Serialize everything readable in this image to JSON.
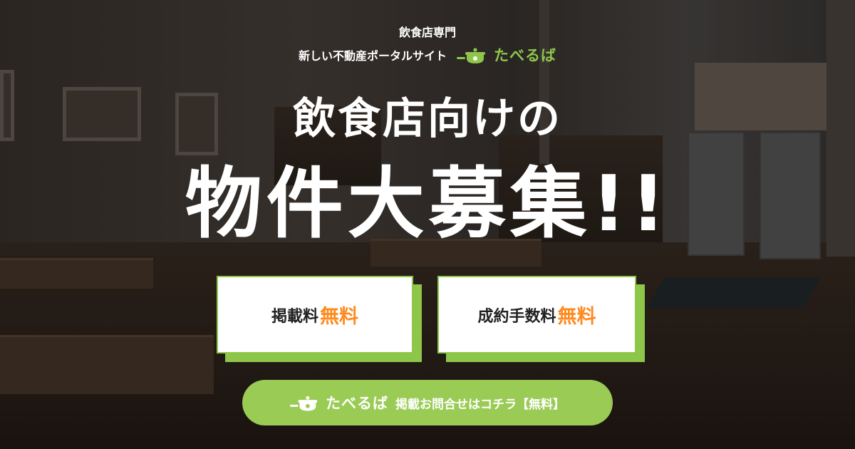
{
  "header": {
    "line1": "飲食店専門",
    "line2": "新しい不動産ポータルサイト",
    "brand_name": "たべるば",
    "brand_icon": "pot-icon"
  },
  "hero": {
    "headline1": "飲食店向けの",
    "headline2": "物件大募集!!"
  },
  "cards": [
    {
      "label": "掲載料",
      "highlight": "無料"
    },
    {
      "label": "成約手数料",
      "highlight": "無料"
    }
  ],
  "cta": {
    "brand_name": "たべるば",
    "label": "掲載お問合せはコチラ【無料】"
  },
  "colors": {
    "accent_green": "#8ec64a",
    "cta_green": "#9acb55",
    "highlight_orange": "#ff8a1e",
    "text_white": "#ffffff"
  }
}
